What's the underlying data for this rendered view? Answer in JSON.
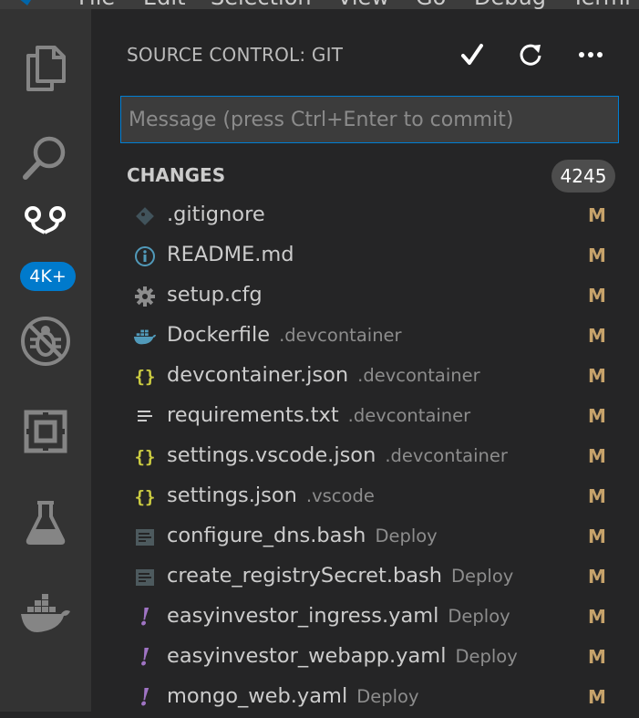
{
  "menubar": {
    "items": [
      "File",
      "Edit",
      "Selection",
      "View",
      "Go",
      "Debug",
      "Termi"
    ]
  },
  "activity": {
    "explorer": "files-icon",
    "search": "search-icon",
    "scm": "source-control-icon",
    "scm_badge": "4K+",
    "debug": "no-debug-icon",
    "extensions": "extensions-icon",
    "test": "flask-icon",
    "docker": "docker-icon"
  },
  "sidebar": {
    "title": "SOURCE CONTROL: GIT",
    "commit_placeholder": "Message (press Ctrl+Enter to commit)",
    "changes_label": "CHANGES",
    "changes_count": "4245",
    "files": [
      {
        "name": ".gitignore",
        "dir": "",
        "status": "M",
        "icon": "git-icon"
      },
      {
        "name": "README.md",
        "dir": "",
        "status": "M",
        "icon": "info-icon"
      },
      {
        "name": "setup.cfg",
        "dir": "",
        "status": "M",
        "icon": "gear-icon"
      },
      {
        "name": "Dockerfile",
        "dir": ".devcontainer",
        "status": "M",
        "icon": "docker-icon"
      },
      {
        "name": "devcontainer.json",
        "dir": ".devcontainer",
        "status": "M",
        "icon": "json-icon"
      },
      {
        "name": "requirements.txt",
        "dir": ".devcontainer",
        "status": "M",
        "icon": "text-file-icon"
      },
      {
        "name": "settings.vscode.json",
        "dir": ".devcontainer",
        "status": "M",
        "icon": "json-icon"
      },
      {
        "name": "settings.json",
        "dir": ".vscode",
        "status": "M",
        "icon": "json-icon"
      },
      {
        "name": "configure_dns.bash",
        "dir": "Deploy",
        "status": "M",
        "icon": "shell-icon"
      },
      {
        "name": "create_registrySecret.bash",
        "dir": "Deploy",
        "status": "M",
        "icon": "shell-icon"
      },
      {
        "name": "easyinvestor_ingress.yaml",
        "dir": "Deploy",
        "status": "M",
        "icon": "yaml-icon"
      },
      {
        "name": "easyinvestor_webapp.yaml",
        "dir": "Deploy",
        "status": "M",
        "icon": "yaml-icon"
      },
      {
        "name": "mongo_web.yaml",
        "dir": "Deploy",
        "status": "M",
        "icon": "yaml-icon"
      }
    ]
  },
  "colors": {
    "accent": "#007acc",
    "modified": "#c7a36b",
    "json": "#cbcb41",
    "yaml": "#a074c4",
    "docker": "#519aba"
  }
}
